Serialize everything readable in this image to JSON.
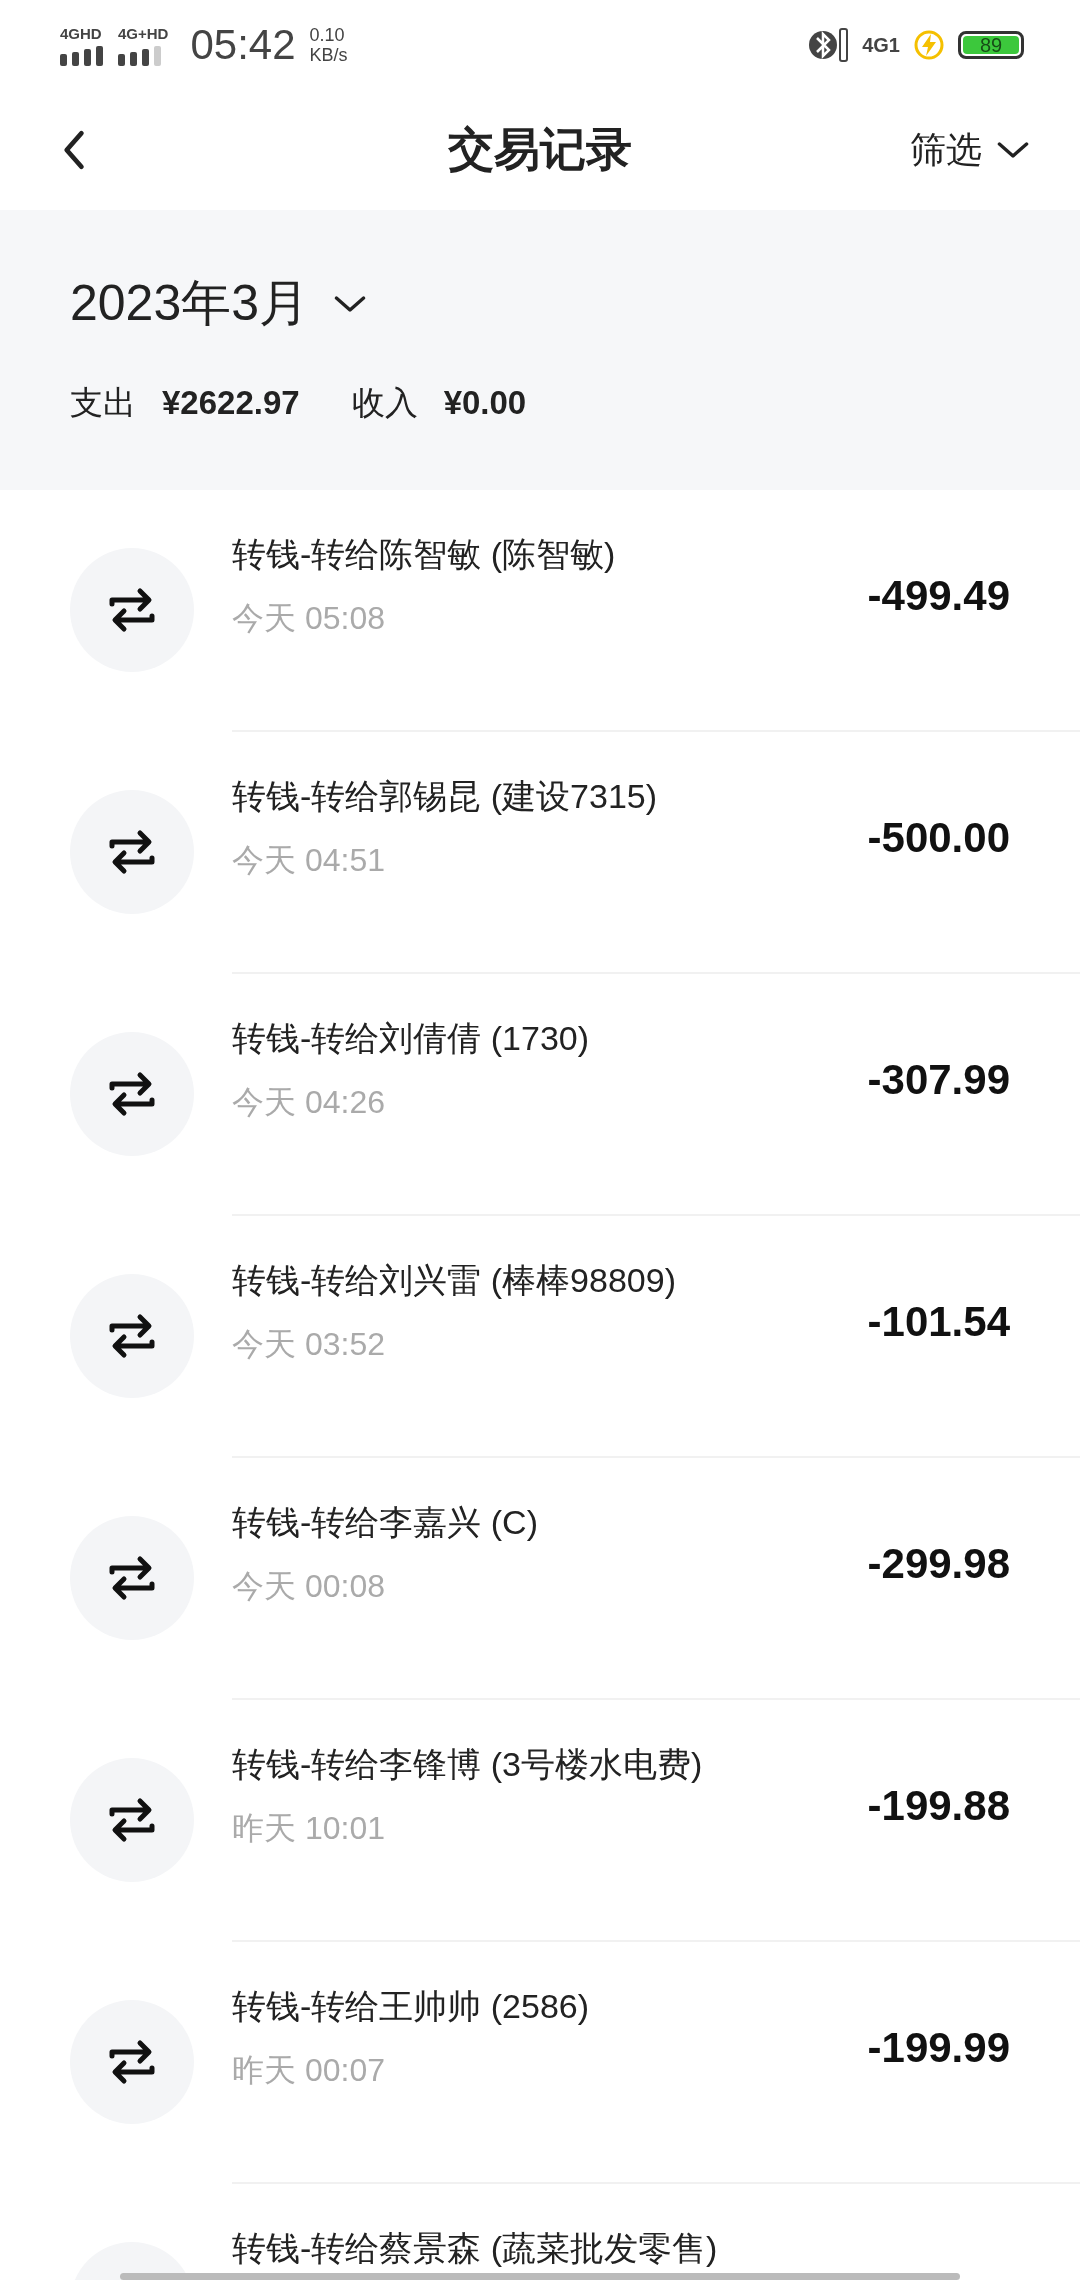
{
  "status_bar": {
    "signal_1": "4GHD",
    "signal_2": "4G+HD",
    "time": "05:42",
    "speed": "0.10",
    "speed_unit": "KB/s",
    "network": "4G1",
    "battery": "89"
  },
  "header": {
    "title": "交易记录",
    "filter": "筛选"
  },
  "summary": {
    "month": "2023年3月",
    "expense_label": "支出",
    "expense": "¥2622.97",
    "income_label": "收入",
    "income": "¥0.00"
  },
  "transactions": [
    {
      "title": "转钱-转给陈智敏 (陈智敏)",
      "time": "今天 05:08",
      "amount": "-499.49"
    },
    {
      "title": "转钱-转给郭锡昆 (建设7315)",
      "time": "今天 04:51",
      "amount": "-500.00"
    },
    {
      "title": "转钱-转给刘倩倩 (1730)",
      "time": "今天 04:26",
      "amount": "-307.99"
    },
    {
      "title": "转钱-转给刘兴雷 (棒棒98809)",
      "time": "今天 03:52",
      "amount": "-101.54"
    },
    {
      "title": "转钱-转给李嘉兴 (C)",
      "time": "今天 00:08",
      "amount": "-299.98"
    },
    {
      "title": "转钱-转给李锋博 (3号楼水电费)",
      "time": "昨天 10:01",
      "amount": "-199.88"
    },
    {
      "title": "转钱-转给王帅帅 (2586)",
      "time": "昨天 00:07",
      "amount": "-199.99"
    },
    {
      "title": "转钱-转给蔡景森 (蔬菜批发零售)"
    }
  ]
}
